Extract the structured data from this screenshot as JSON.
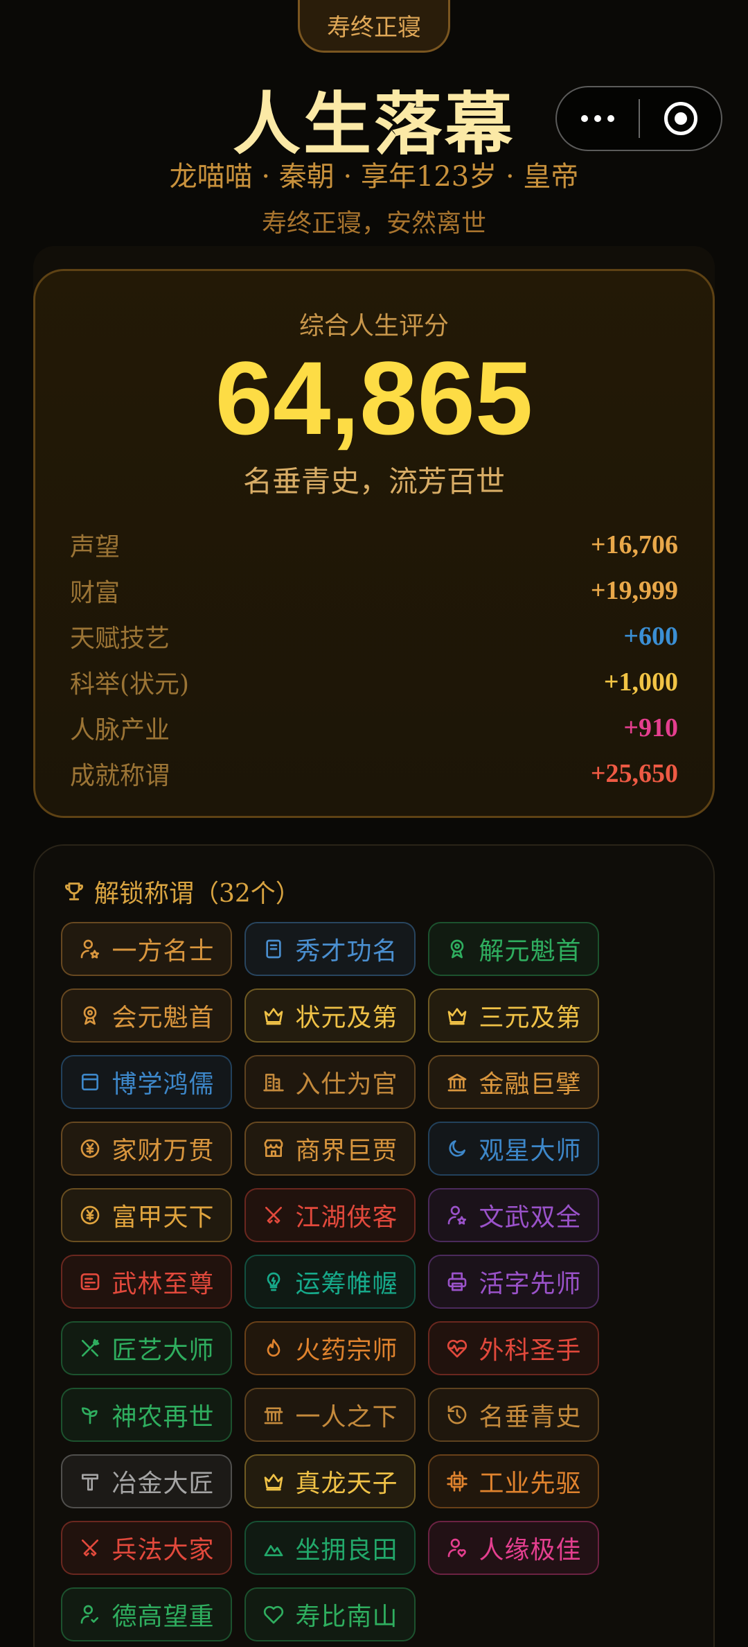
{
  "top_tag": "寿终正寝",
  "header": {
    "title": "人生落幕",
    "subtitle": "龙喵喵 · 秦朝 · 享年123岁 · 皇帝",
    "death_note": "寿终正寝，安然离世"
  },
  "score": {
    "label": "综合人生评分",
    "value": "64,865",
    "phrase": "名垂青史，流芳百世",
    "items": [
      {
        "label": "声望",
        "value": "+16,706",
        "color": "#e9a84a"
      },
      {
        "label": "财富",
        "value": "+19,999",
        "color": "#e9a84a"
      },
      {
        "label": "天赋技艺",
        "value": "+600",
        "color": "#3b8fd4"
      },
      {
        "label": "科举(状元)",
        "value": "+1,000",
        "color": "#f2c445"
      },
      {
        "label": "人脉产业",
        "value": "+910",
        "color": "#e43f8f"
      },
      {
        "label": "成就称谓",
        "value": "+25,650",
        "color": "#ee5a44"
      }
    ]
  },
  "titles": {
    "heading": "解锁称谓（32个）",
    "items": [
      {
        "label": "一方名士",
        "icon": "person-star-icon",
        "color": "#d9963e"
      },
      {
        "label": "秀才功名",
        "icon": "book-icon",
        "color": "#4a8fd0"
      },
      {
        "label": "解元魁首",
        "icon": "award-icon",
        "color": "#2fae5f"
      },
      {
        "label": "会元魁首",
        "icon": "award-icon",
        "color": "#d9963e"
      },
      {
        "label": "状元及第",
        "icon": "crown-icon",
        "color": "#f0c247"
      },
      {
        "label": "三元及第",
        "icon": "crown-icon",
        "color": "#f0c247"
      },
      {
        "label": "博学鸿儒",
        "icon": "window-icon",
        "color": "#3d87c9"
      },
      {
        "label": "入仕为官",
        "icon": "building-icon",
        "color": "#c48a3c"
      },
      {
        "label": "金融巨擘",
        "icon": "bank-icon",
        "color": "#d9963e"
      },
      {
        "label": "家财万贯",
        "icon": "yen-coin-icon",
        "color": "#d9963e"
      },
      {
        "label": "商界巨贾",
        "icon": "store-icon",
        "color": "#d9963e"
      },
      {
        "label": "观星大师",
        "icon": "moon-icon",
        "color": "#3d87c9"
      },
      {
        "label": "富甲天下",
        "icon": "yen-coin-icon",
        "color": "#e0a43e"
      },
      {
        "label": "江湖侠客",
        "icon": "crossed-swords-icon",
        "color": "#e2493c"
      },
      {
        "label": "文武双全",
        "icon": "person-star-icon",
        "color": "#9a52c9"
      },
      {
        "label": "武林至尊",
        "icon": "scroll-icon",
        "color": "#e2493c"
      },
      {
        "label": "运筹帷幄",
        "icon": "lightbulb-icon",
        "color": "#17a98a"
      },
      {
        "label": "活字先师",
        "icon": "printer-icon",
        "color": "#9a52c9"
      },
      {
        "label": "匠艺大师",
        "icon": "tools-icon",
        "color": "#2fae5f"
      },
      {
        "label": "火药宗师",
        "icon": "flame-icon",
        "color": "#e0832e"
      },
      {
        "label": "外科圣手",
        "icon": "heart-pulse-icon",
        "color": "#e2493c"
      },
      {
        "label": "神农再世",
        "icon": "sprout-icon",
        "color": "#2fae5f"
      },
      {
        "label": "一人之下",
        "icon": "landmark-icon",
        "color": "#c48a3c"
      },
      {
        "label": "名垂青史",
        "icon": "history-icon",
        "color": "#c48a3c"
      },
      {
        "label": "冶金大匠",
        "icon": "hammer-icon",
        "color": "#a5a5a5"
      },
      {
        "label": "真龙天子",
        "icon": "crown-icon",
        "color": "#f0c247"
      },
      {
        "label": "工业先驱",
        "icon": "chip-icon",
        "color": "#e0832e"
      },
      {
        "label": "兵法大家",
        "icon": "crossed-swords-icon",
        "color": "#e2493c"
      },
      {
        "label": "坐拥良田",
        "icon": "mountain-icon",
        "color": "#22a86a"
      },
      {
        "label": "人缘极佳",
        "icon": "person-heart-icon",
        "color": "#e43f8f"
      },
      {
        "label": "德高望重",
        "icon": "person-check-icon",
        "color": "#2fae5f"
      },
      {
        "label": "寿比南山",
        "icon": "heart-icon",
        "color": "#2fae5f"
      }
    ]
  }
}
